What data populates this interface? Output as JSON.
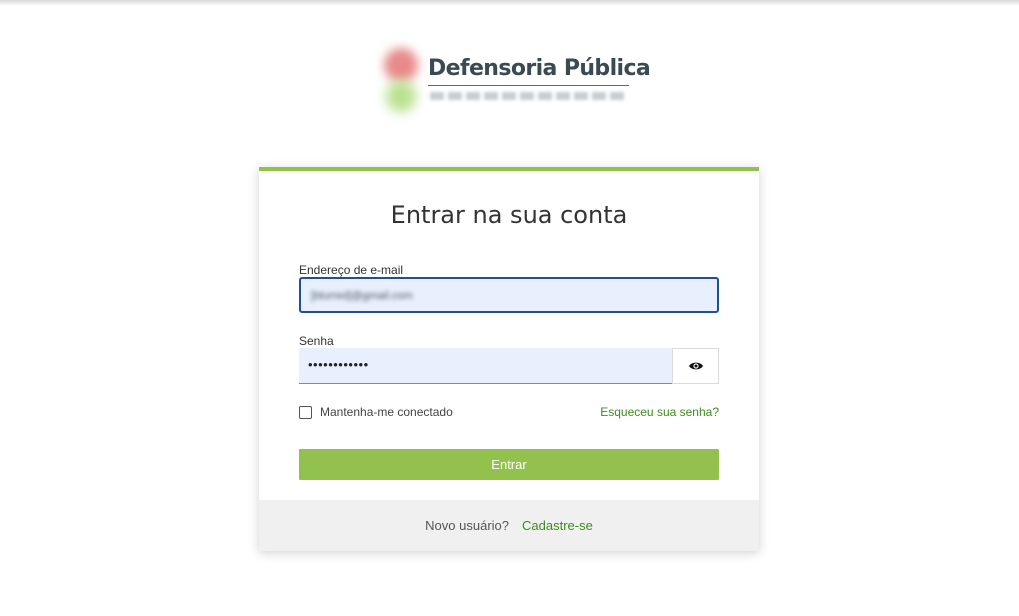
{
  "brand": {
    "title": "Defensoria Pública",
    "subtitle": "ESTADO DE SÃO PAULO"
  },
  "login": {
    "heading": "Entrar na sua conta",
    "email": {
      "label": "Endereço de e-mail",
      "value": "[blurred]@gmail.com"
    },
    "password": {
      "label": "Senha",
      "value": "••••••••••••"
    },
    "remember_label": "Mantenha-me conectado",
    "forgot_label": "Esqueceu sua senha?",
    "submit_label": "Entrar",
    "footer": {
      "prompt": "Novo usuário?",
      "signup_label": "Cadastre-se"
    }
  },
  "colors": {
    "accent": "#92c14e",
    "link": "#3d8b1f",
    "input_focus_border": "#1f4f97",
    "autofill_bg": "#e8f0fe"
  },
  "icons": {
    "password_toggle": "eye-icon"
  }
}
